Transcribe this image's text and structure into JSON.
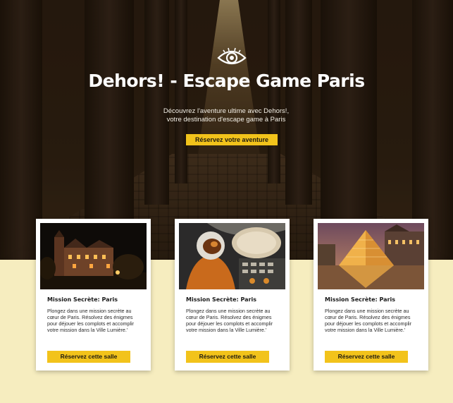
{
  "hero": {
    "title": "Dehors! - Escape Game Paris",
    "subtitle_line1": "Découvrez l'aventure ultime avec Dehors!,",
    "subtitle_line2": "votre destination d'escape game à Paris",
    "cta_label": "Réservez votre aventure",
    "icon": "eye-icon"
  },
  "cards": [
    {
      "title": "Mission Secrète: Paris",
      "text": "Plongez dans une mission secrète au cœur de Paris. Résolvez des énigmes pour déjouer les complots et accomplir votre mission dans la Ville Lumière.'",
      "button_label": "Réservez cette salle",
      "image": "castle-at-night"
    },
    {
      "title": "Mission Secrète: Paris",
      "text": "Plongez dans une mission secrète au cœur de Paris. Résolvez des énigmes pour déjouer les complots et accomplir votre mission dans la Ville Lumière.'",
      "button_label": "Réservez cette salle",
      "image": "astronaut-cockpit"
    },
    {
      "title": "Mission Secrète: Paris",
      "text": "Plongez dans une mission secrète au cœur de Paris. Résolvez des énigmes pour déjouer les complots et accomplir votre mission dans la Ville Lumière.'",
      "button_label": "Réservez cette salle",
      "image": "louvre-pyramid"
    }
  ],
  "colors": {
    "accent": "#f2c31b",
    "page_background": "#f6edbf",
    "hero_dark": "#2a1c10"
  }
}
